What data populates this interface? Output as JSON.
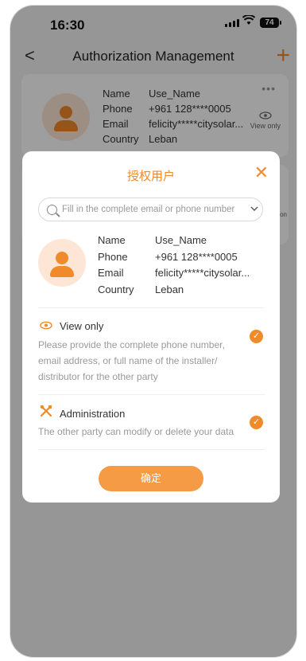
{
  "status": {
    "time": "16:30",
    "battery": "74"
  },
  "nav": {
    "title": "Authorization Management",
    "back": "<",
    "add": "+"
  },
  "card": {
    "rows": [
      {
        "key": "Name",
        "value": "Use_Name"
      },
      {
        "key": "Phone",
        "value": "+961 128****0005"
      },
      {
        "key": "Email",
        "value": "felicity*****citysolar..."
      },
      {
        "key": "Country",
        "value": "Leban"
      }
    ],
    "more": "•••",
    "permission": "View only"
  },
  "card2": {
    "side_partial": "ion"
  },
  "modal": {
    "title": "授权用户",
    "close": "✕",
    "search_placeholder": "Fill in the complete email or phone number",
    "user": {
      "rows": [
        {
          "key": "Name",
          "value": "Use_Name"
        },
        {
          "key": "Phone",
          "value": "+961 128****0005"
        },
        {
          "key": "Email",
          "value": "felicity*****citysolar..."
        },
        {
          "key": "Country",
          "value": "Leban"
        }
      ]
    },
    "options": [
      {
        "title": "View only",
        "icon": "eye-icon",
        "desc": "Please provide the complete phone number, email address, or full name of the installer/ distributor for the other party",
        "checked": true
      },
      {
        "title": "Administration",
        "icon": "tools-icon",
        "desc": "The other party can modify or delete your data",
        "checked": true
      }
    ],
    "confirm": "确定"
  },
  "colors": {
    "accent": "#f08a2a",
    "overlay": "rgba(0,0,0,0.38)"
  }
}
